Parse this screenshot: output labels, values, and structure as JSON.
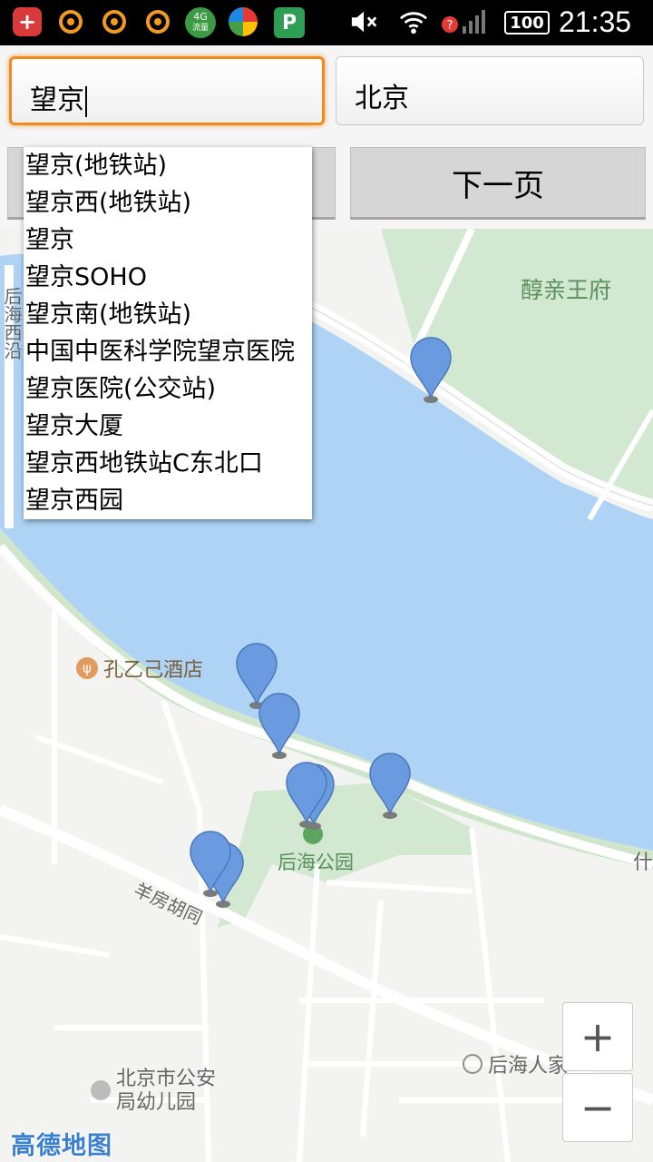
{
  "status_bar": {
    "time": "21:35",
    "battery": "100",
    "network_badge_top": "4G",
    "network_badge_bottom": "流量",
    "p_icon_label": "P"
  },
  "search": {
    "from_value": "望京",
    "to_value": "北京"
  },
  "buttons": {
    "left_label": "",
    "next_label": "下一页"
  },
  "suggestions": [
    "望京(地铁站)",
    "望京西(地铁站)",
    "望京",
    "望京SOHO",
    "望京南(地铁站)",
    "中国中医科学院望京医院",
    "望京医院(公交站)",
    "望京大厦",
    "望京西地铁站C东北口",
    "望京西园"
  ],
  "map": {
    "labels": {
      "chunqin": "醇亲王府",
      "houhai_xiyan": "后海西沿",
      "kongyiji": "孔乙己酒店",
      "houhai_park": "后海公园",
      "yangfang": "羊房胡同",
      "houhai_renjia": "后海人家",
      "kindergarten_1": "北京市公安",
      "kindergarten_2": "局幼儿园",
      "shi": "什"
    },
    "zoom_in": "+",
    "zoom_out": "−",
    "logo": "高德地图",
    "colors": {
      "water": "#aed3f5",
      "park": "#cfe6cc",
      "road": "#ffffff",
      "marker": "#6a9be0"
    }
  }
}
